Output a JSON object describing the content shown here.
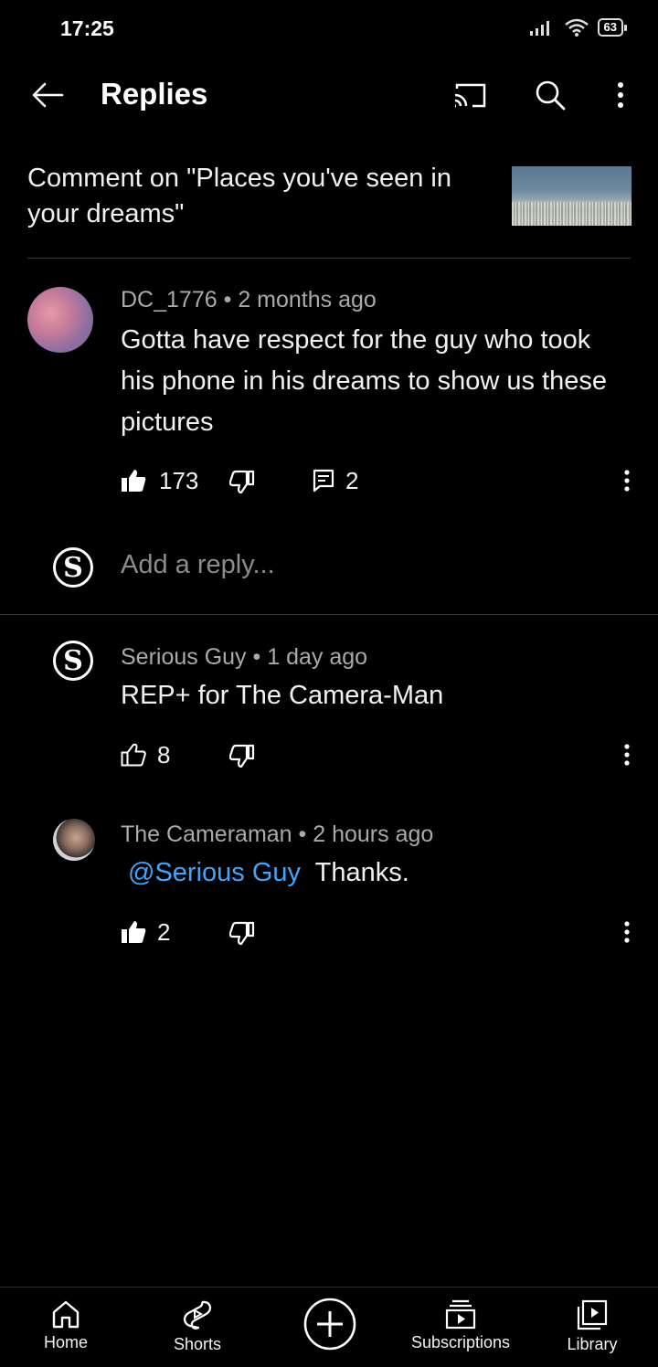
{
  "status": {
    "time": "17:25",
    "battery": "63"
  },
  "header": {
    "title": "Replies"
  },
  "context": {
    "text": "Comment on \"Places you've seen in your dreams\""
  },
  "parent_comment": {
    "author": "DC_1776",
    "age": "2 months ago",
    "separator": "•",
    "text": "Gotta have respect for the guy who took his phone in his dreams to show us these pictures",
    "likes": "173",
    "replies": "2"
  },
  "reply_box": {
    "placeholder": "Add a reply..."
  },
  "replies": [
    {
      "author": "Serious Guy",
      "age": "1 day ago",
      "text": "REP+ for The Camera-Man",
      "likes": "8",
      "avatar_letter": "S"
    },
    {
      "author": "The Cameraman",
      "age": "2 hours ago",
      "mention": "@Serious Guy",
      "text": "Thanks.",
      "likes": "2"
    }
  ],
  "nav": [
    {
      "label": "Home",
      "icon": "home-icon"
    },
    {
      "label": "Shorts",
      "icon": "shorts-icon"
    },
    {
      "label": "",
      "icon": "create-icon"
    },
    {
      "label": "Subscriptions",
      "icon": "subscriptions-icon"
    },
    {
      "label": "Library",
      "icon": "library-icon"
    }
  ],
  "colors": {
    "background": "#000000",
    "link": "#3ea6ff",
    "meta": "#aaaaaa"
  }
}
